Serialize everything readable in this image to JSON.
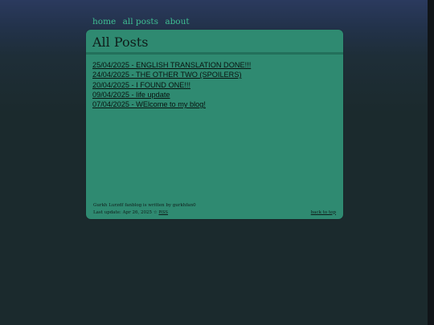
{
  "nav": {
    "home": "home",
    "all_posts": "all posts",
    "about": "about"
  },
  "page": {
    "title": "All Posts"
  },
  "posts": [
    {
      "label": "25/04/2025 - ENGLISH TRANSLATION DONE!!!"
    },
    {
      "label": "24/04/2025 - THE OTHER TWO (SPOILERS)"
    },
    {
      "label": "20/04/2025 - I FOUND ONE!!!"
    },
    {
      "label": "09/04/2025 - life update"
    },
    {
      "label": "07/04/2025 - WElcome to my blog!"
    }
  ],
  "footer": {
    "credit": "Gurkh Lurzdf fanblog is written by gurkhfan0",
    "last_update": "Last update: Apr 26, 2025 ☆",
    "rss": "RSS",
    "back_to_top": "back to top"
  },
  "colors": {
    "nav_link": "#3fbf93",
    "card_bg": "#2f8a71",
    "page_bg": "#1b2a2d"
  }
}
